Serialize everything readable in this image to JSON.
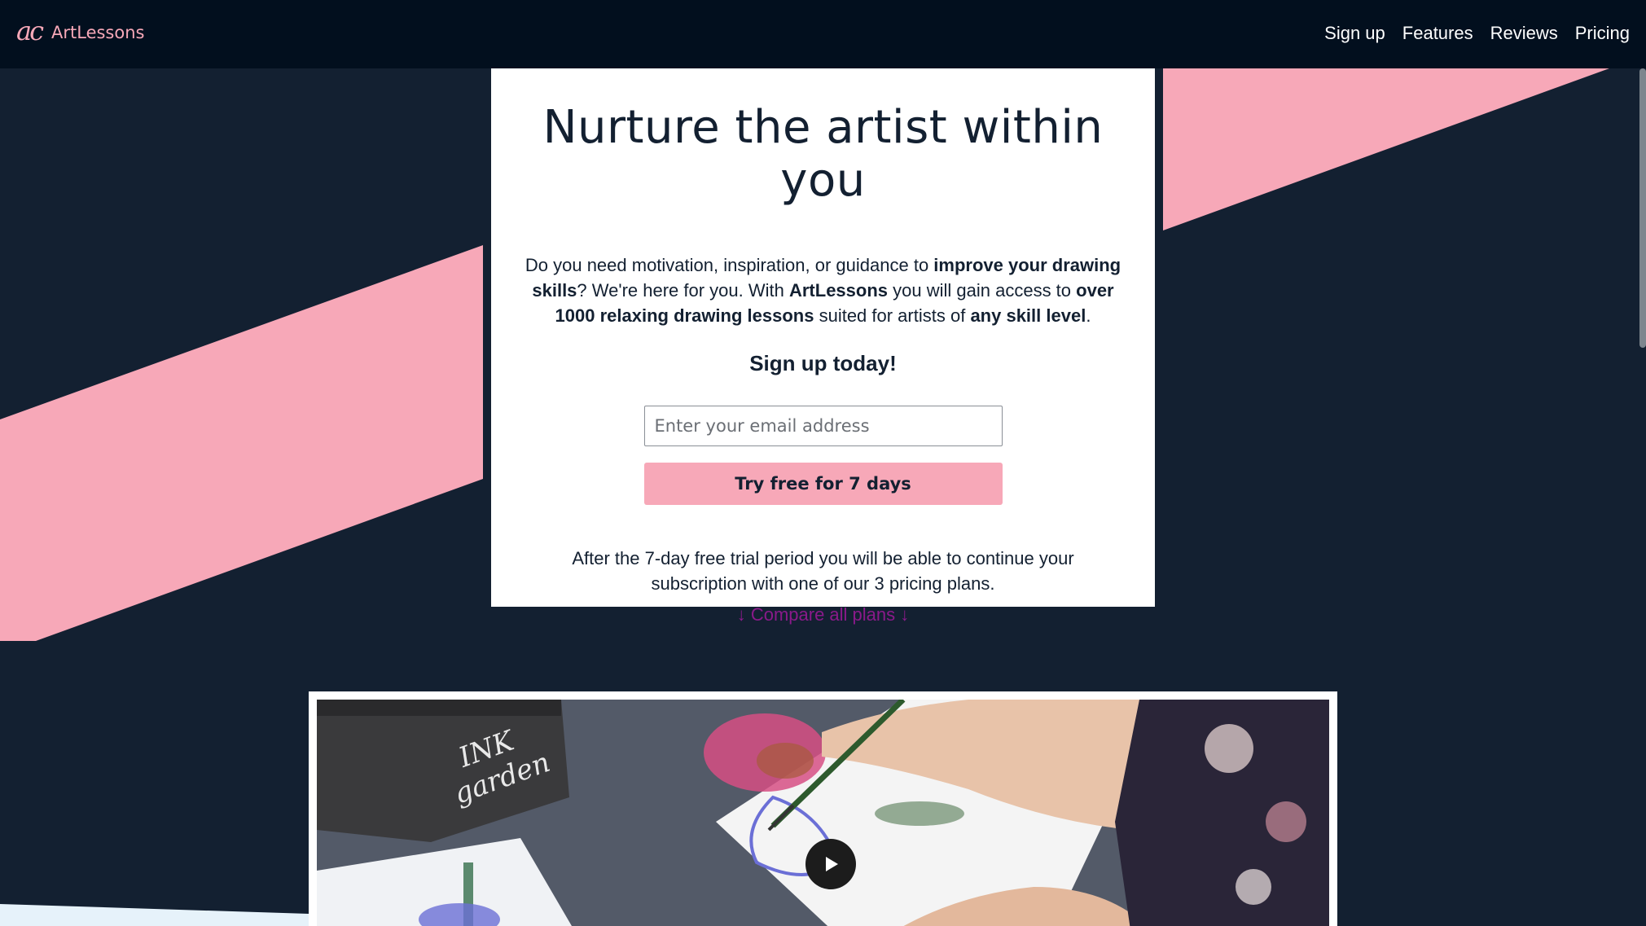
{
  "brand": {
    "logo_text": "ac",
    "name": "ArtLessons"
  },
  "nav": {
    "items": [
      {
        "label": "Sign up"
      },
      {
        "label": "Features"
      },
      {
        "label": "Reviews"
      },
      {
        "label": "Pricing"
      }
    ]
  },
  "hero": {
    "title": "Nurture the artist within you",
    "desc_1": "Do you need motivation, inspiration, or guidance to ",
    "desc_2": "improve your drawing skills",
    "desc_3": "? We're here for you. With ",
    "desc_4": "ArtLessons",
    "desc_5": " you will gain access to ",
    "desc_6": "over 1000 relaxing drawing lessons",
    "desc_7": " suited for artists of ",
    "desc_8": "any skill level",
    "desc_9": ".",
    "signup_heading": "Sign up today!",
    "email_placeholder": "Enter your email address",
    "button_label": "Try free for 7 days",
    "trial_note": "After the 7-day free trial period you will be able to continue your subscription with one of our 3 pricing plans.",
    "compare_link": "↓ Compare all plans ↓"
  },
  "video": {
    "box_text": "INK garden"
  },
  "colors": {
    "background": "#132031",
    "navbar": "#020f1e",
    "accent_pink": "#f7a8b8",
    "link_purple": "#8a1a8a"
  }
}
